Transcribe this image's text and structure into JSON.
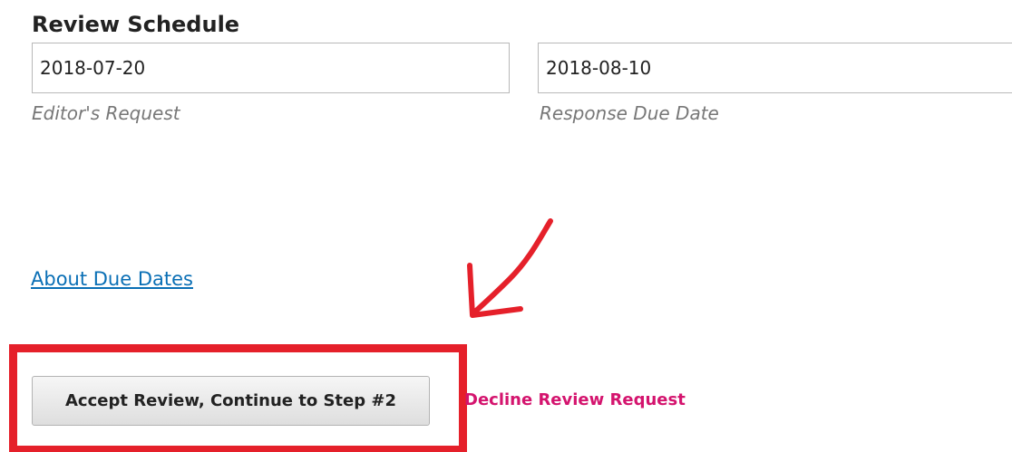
{
  "review_schedule": {
    "title": "Review Schedule",
    "editor_request": {
      "value": "2018-07-20",
      "hint": "Editor's Request"
    },
    "response_due": {
      "value": "2018-08-10",
      "hint": "Response Due Date"
    }
  },
  "links": {
    "about_due_dates": "About Due Dates",
    "decline": "Decline Review Request"
  },
  "actions": {
    "accept_label": "Accept Review, Continue to Step #2"
  },
  "annotation": {
    "color": "#e5202a",
    "icon": "red-arrow-icon"
  },
  "colors": {
    "link": "#0a6fb5",
    "decline": "#d4146e",
    "hint": "#777777"
  }
}
